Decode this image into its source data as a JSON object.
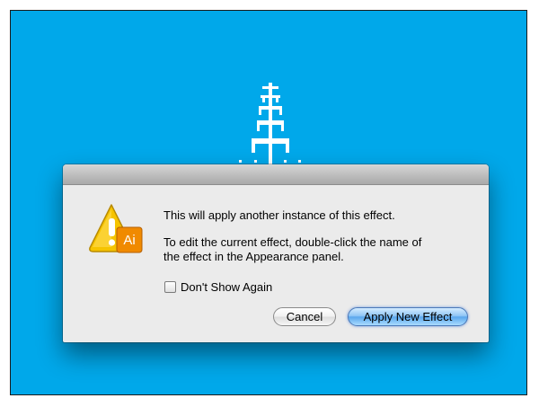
{
  "dialog": {
    "message_line1": "This will apply another instance of this effect.",
    "message_line2": "To edit the current effect, double-click the name of",
    "message_line3": "the effect in the Appearance panel.",
    "checkbox_label": "Don't Show Again",
    "checkbox_checked": false,
    "cancel_label": "Cancel",
    "apply_label": "Apply New Effect",
    "icon": "warning-triangle-with-app-badge",
    "badge_text": "Ai"
  },
  "colors": {
    "canvas_background": "#00a8ea",
    "warning_yellow": "#f6c400",
    "app_badge_orange": "#f08a00",
    "default_button_blue": "#5aa7ed"
  }
}
